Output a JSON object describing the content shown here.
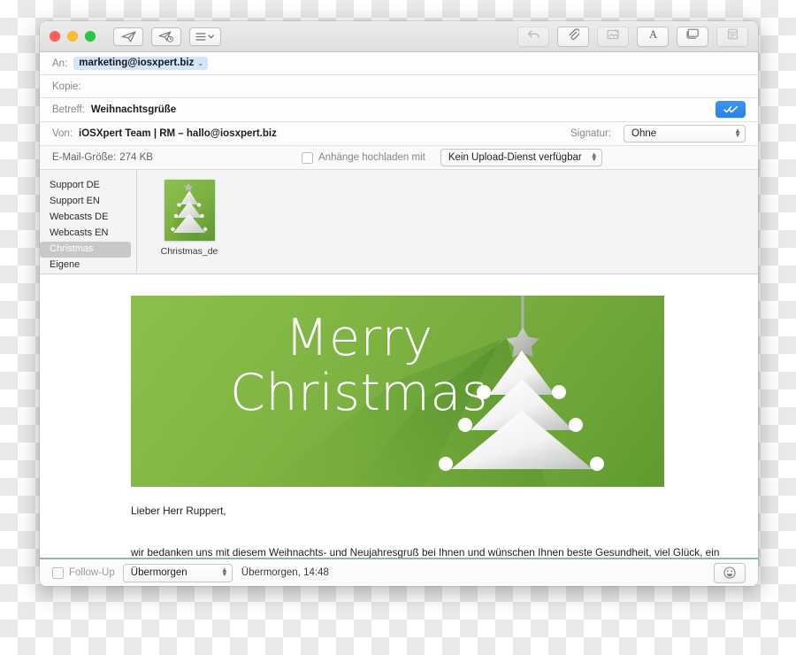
{
  "window": {
    "traffic_lights": [
      "close",
      "minimize",
      "maximize"
    ],
    "toolbar_left": [
      {
        "name": "send-button",
        "icon": "paper-plane-icon",
        "label": "Senden"
      },
      {
        "name": "send-later-button",
        "icon": "paper-plane-clock-icon",
        "label": "Später senden"
      },
      {
        "name": "header-fields-button",
        "icon": "list-chevron-icon",
        "label": "Kopfzeilenfelder"
      }
    ],
    "toolbar_right": [
      {
        "name": "undo-button",
        "icon": "undo-arrow-icon",
        "label": "Widerrufen"
      },
      {
        "name": "attach-button",
        "icon": "paperclip-icon",
        "label": "Anhang"
      },
      {
        "name": "markup-button",
        "icon": "markup-photo-icon",
        "label": "Markierung"
      },
      {
        "name": "format-button",
        "icon": "format-a-icon",
        "label": "Format"
      },
      {
        "name": "stationery-button",
        "icon": "window-icon",
        "label": "Briefpapier"
      },
      {
        "name": "template-button",
        "icon": "note-icon",
        "label": "Vorlagen"
      }
    ]
  },
  "header": {
    "to": {
      "label": "An:",
      "value": "marketing@iosxpert.biz",
      "chevron": "⌄"
    },
    "cc": {
      "label": "Kopie:",
      "value": ""
    },
    "subject": {
      "label": "Betreff:",
      "value": "Weihnachtsgrüße"
    },
    "from": {
      "label": "Von:",
      "value": "iOSXpert Team | RM – hallo@iosxpert.biz"
    },
    "tracking_badge": {
      "name": "read-receipt-badge",
      "glyph": "✓✓",
      "color": "#2a81e8"
    },
    "signature": {
      "label": "Signatur:",
      "value": "Ohne"
    },
    "mail_size": {
      "label": "E-Mail-Größe:",
      "value": "274 KB"
    },
    "upload": {
      "checkbox_label": "Anhänge hochladen mit",
      "checked": false,
      "service": "Kein Upload-Dienst verfügbar"
    }
  },
  "template_picker": {
    "categories": [
      {
        "label": "Support DE",
        "selected": false
      },
      {
        "label": "Support EN",
        "selected": false
      },
      {
        "label": "Webcasts DE",
        "selected": false
      },
      {
        "label": "Webcasts EN",
        "selected": false
      },
      {
        "label": "Christmas",
        "selected": true
      },
      {
        "label": "Eigene",
        "selected": false
      }
    ],
    "thumbnails": [
      {
        "caption": "Christmas_de",
        "icon": "christmas-tree-thumbnail"
      }
    ]
  },
  "message": {
    "banner": {
      "line1": "Merry",
      "line2": "Christmas",
      "bg_from": "#8cbf4d",
      "bg_to": "#5f9b31",
      "art": "christmas-tree-illustration"
    },
    "greeting": "Lieber Herr Ruppert,",
    "paragraph": "wir bedanken uns mit diesem Weihnachts- und Neujahresgruß bei Ihnen und wünschen Ihnen beste Gesundheit, viel Glück, ein schönes neues Jahr sowie eine besinnliche Weihnachtszeit. Viel Erfolg im"
  },
  "footer": {
    "follow_up": {
      "label": "Follow-Up",
      "checked": false
    },
    "when": "Übermorgen",
    "when_detail": "Übermorgen, 14:48",
    "emoji_button": {
      "name": "emoji-button",
      "glyph": "☺"
    }
  }
}
